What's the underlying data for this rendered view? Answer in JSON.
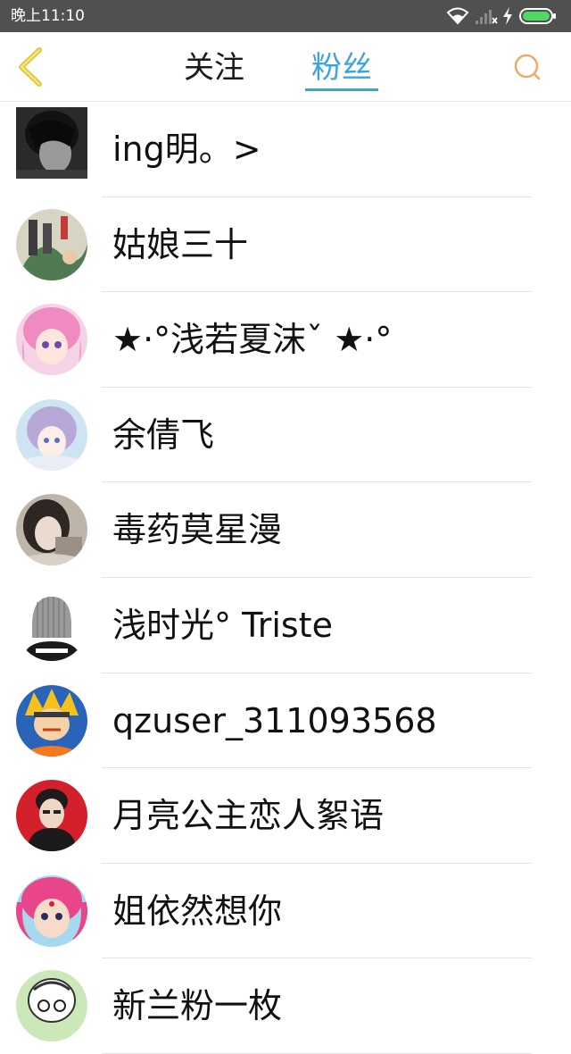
{
  "status_bar": {
    "time": "晚上11:10",
    "icons": [
      "wifi-icon",
      "signal-icon",
      "charging-icon",
      "battery-icon"
    ]
  },
  "header": {
    "back_icon": "chevron-left-icon",
    "tabs": [
      {
        "label": "关注",
        "active": false
      },
      {
        "label": "粉丝",
        "active": true
      }
    ],
    "search_icon": "search-icon",
    "accent_color": "#3aa3e0",
    "back_color": "#e2c83a",
    "search_color": "#f0a868"
  },
  "fans": [
    {
      "name": "ing明。>"
    },
    {
      "name": "姑娘三十"
    },
    {
      "name": "★·°浅若夏沫ˇ ★·°"
    },
    {
      "name": "余倩飞"
    },
    {
      "name": "毒药莫星漫"
    },
    {
      "name": "浅时光° Triste"
    },
    {
      "name": "qzuser_311093568"
    },
    {
      "name": "月亮公主恋人絮语"
    },
    {
      "name": "姐依然想你"
    },
    {
      "name": "新兰粉一枚"
    }
  ]
}
